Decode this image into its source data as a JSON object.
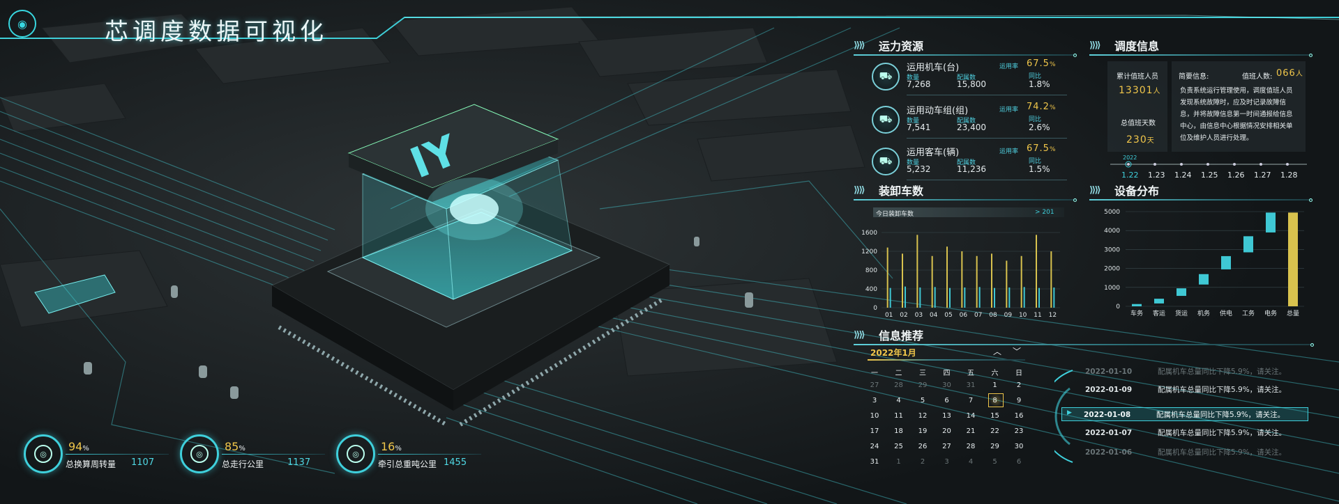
{
  "header": {
    "title": "芯调度数据可视化",
    "logo_icon": "chip-logo-icon"
  },
  "resources": {
    "title": "运力资源",
    "rows": [
      {
        "name": "运用机车(台)",
        "rate_label": "运用率",
        "rate": "67.5",
        "rate_unit": "%",
        "qty_label": "数量",
        "qty": "7,268",
        "cfg_label": "配属数",
        "cfg": "15,800",
        "yoy_label": "同比",
        "yoy": "1.8%",
        "icon": "locomotive-icon"
      },
      {
        "name": "运用动车组(组)",
        "rate_label": "运用率",
        "rate": "74.2",
        "rate_unit": "%",
        "qty_label": "数量",
        "qty": "7,541",
        "cfg_label": "配属数",
        "cfg": "23,400",
        "yoy_label": "同比",
        "yoy": "2.6%",
        "icon": "emu-train-icon"
      },
      {
        "name": "运用客车(辆)",
        "rate_label": "运用率",
        "rate": "67.5",
        "rate_unit": "%",
        "qty_label": "数量",
        "qty": "5,232",
        "cfg_label": "配属数",
        "cfg": "11,236",
        "yoy_label": "同比",
        "yoy": "1.5%",
        "icon": "passenger-car-icon"
      }
    ]
  },
  "schedule": {
    "title": "调度信息",
    "duty_label": "累计值班人员",
    "duty_value": "13301",
    "duty_unit": "人",
    "days_label": "总值班天数",
    "days_value": "230",
    "days_unit": "天",
    "brief_label": "简要信息:",
    "on_duty_label": "值班人数:",
    "on_duty_value": "066",
    "on_duty_unit": "人",
    "description": "负责系统运行管理使用，调度值班人员发现系统故障时，应及时记录故障信息，并将故障信息第一时间通报给信息中心，由信息中心根据情况安排相关单位及维护人员进行处理。",
    "timeline_year": "2022",
    "timeline_dates": [
      "1.22",
      "1.23",
      "1.24",
      "1.25",
      "1.26",
      "1.27",
      "1.28"
    ],
    "timeline_active": 0
  },
  "loading": {
    "title": "装卸车数",
    "today_label": "今日装卸车数",
    "today_value": "201",
    "chart_data": {
      "type": "bar",
      "categories": [
        "01",
        "02",
        "03",
        "04",
        "05",
        "06",
        "07",
        "08",
        "09",
        "10",
        "11",
        "12"
      ],
      "series": [
        {
          "values": [
            1280,
            1150,
            1550,
            1100,
            1300,
            1200,
            1100,
            1150,
            1000,
            1100,
            1550,
            1200
          ]
        },
        {
          "values": [
            420,
            450,
            430,
            440,
            420,
            430,
            440,
            420,
            430,
            440,
            420,
            430
          ]
        }
      ],
      "ylim": [
        0,
        1600
      ],
      "yticks": [
        0,
        400,
        800,
        1200,
        1600
      ],
      "colors": [
        "#d8c24e",
        "#3fc8d4"
      ]
    }
  },
  "equipment": {
    "title": "设备分布",
    "chart_data": {
      "type": "waterfall-bar",
      "categories": [
        "车务",
        "客运",
        "货运",
        "机务",
        "供电",
        "工务",
        "电务",
        "总量"
      ],
      "ranges": [
        [
          0,
          120
        ],
        [
          150,
          400
        ],
        [
          550,
          950
        ],
        [
          1150,
          1700
        ],
        [
          1950,
          2650
        ],
        [
          2850,
          3700
        ],
        [
          3900,
          4950
        ],
        [
          0,
          4950
        ]
      ],
      "ylim": [
        0,
        5000
      ],
      "yticks": [
        0,
        1000,
        2000,
        3000,
        4000,
        5000
      ],
      "colors": [
        "#3fc8d4",
        "#d8c24e"
      ]
    }
  },
  "news": {
    "title": "信息推荐",
    "calendar": {
      "month_label": "2022年1月",
      "weekdays": [
        "一",
        "二",
        "三",
        "四",
        "五",
        "六",
        "日"
      ],
      "days": [
        [
          "27",
          "28",
          "29",
          "30",
          "31",
          "1",
          "2"
        ],
        [
          "3",
          "4",
          "5",
          "6",
          "7",
          "8",
          "9"
        ],
        [
          "10",
          "11",
          "12",
          "13",
          "14",
          "15",
          "16"
        ],
        [
          "17",
          "18",
          "19",
          "20",
          "21",
          "22",
          "23"
        ],
        [
          "24",
          "25",
          "26",
          "27",
          "28",
          "29",
          "30"
        ],
        [
          "31",
          "1",
          "2",
          "3",
          "4",
          "5",
          "6"
        ]
      ],
      "selected": "8"
    },
    "items": [
      {
        "date": "2022-01-10",
        "text": "配属机车总量同比下降5.9%，请关注。"
      },
      {
        "date": "2022-01-09",
        "text": "配属机车总量同比下降5.9%，请关注。"
      },
      {
        "date": "2022-01-08",
        "text": "配属机车总量同比下降5.9%，请关注。"
      },
      {
        "date": "2022-01-07",
        "text": "配属机车总量同比下降5.9%，请关注。"
      },
      {
        "date": "2022-01-06",
        "text": "配属机车总量同比下降5.9%，请关注。"
      }
    ],
    "active_index": 2
  },
  "stats": [
    {
      "pct": "94",
      "label": "总换算周转量",
      "value": "1107",
      "icon": "turnover-icon"
    },
    {
      "pct": "85",
      "label": "总走行公里",
      "value": "1137",
      "icon": "compass-icon"
    },
    {
      "pct": "16",
      "label": "牵引总重吨公里",
      "value": "1455",
      "icon": "weight-icon"
    }
  ],
  "chip_label": "IY"
}
